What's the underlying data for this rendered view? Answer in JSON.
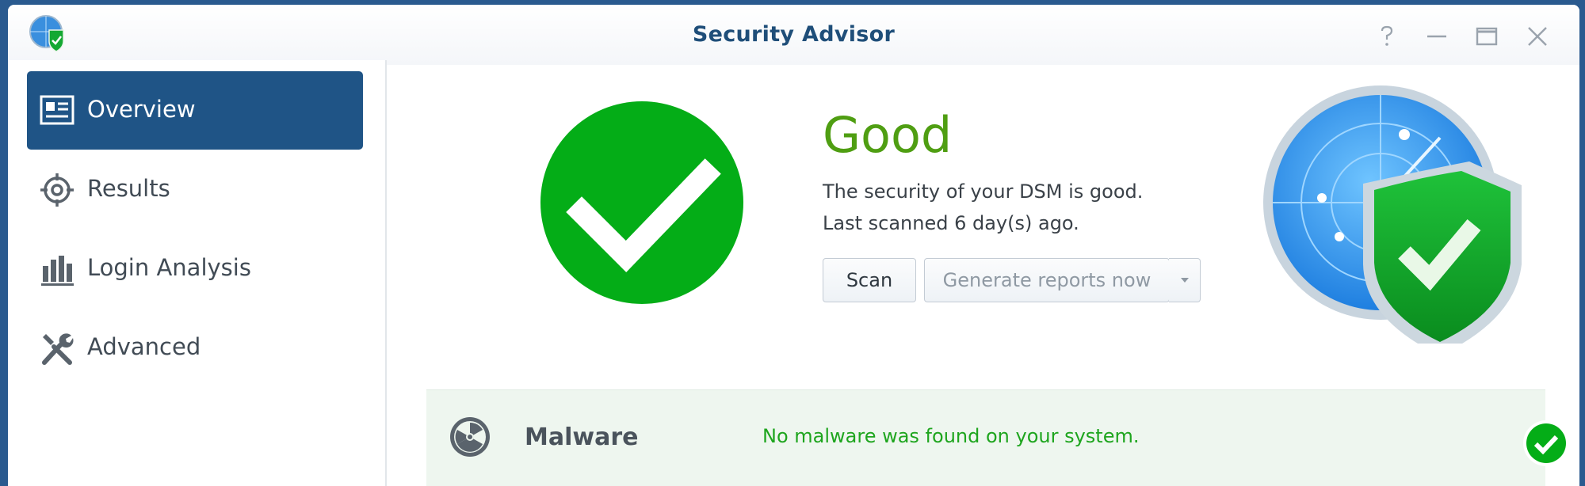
{
  "window": {
    "title": "Security Advisor",
    "controls": [
      "help-icon",
      "minimize-icon",
      "maximize-icon",
      "close-icon"
    ]
  },
  "sidebar": {
    "items": [
      {
        "label": "Overview",
        "icon": "overview-card-icon",
        "active": true
      },
      {
        "label": "Results",
        "icon": "target-icon",
        "active": false
      },
      {
        "label": "Login Analysis",
        "icon": "bar-chart-icon",
        "active": false
      },
      {
        "label": "Advanced",
        "icon": "tools-icon",
        "active": false
      }
    ]
  },
  "status": {
    "title": "Good",
    "description": "The security of your DSM is good.",
    "last_scanned": "Last scanned 6 day(s) ago.",
    "scan_button": "Scan",
    "report_button": "Generate reports now"
  },
  "malware": {
    "name": "Malware",
    "description": "No malware was found on your system."
  },
  "colors": {
    "accent": "#1f5486",
    "good": "#04ad17",
    "good_text": "#4f9e12",
    "title": "#1f4e79"
  }
}
